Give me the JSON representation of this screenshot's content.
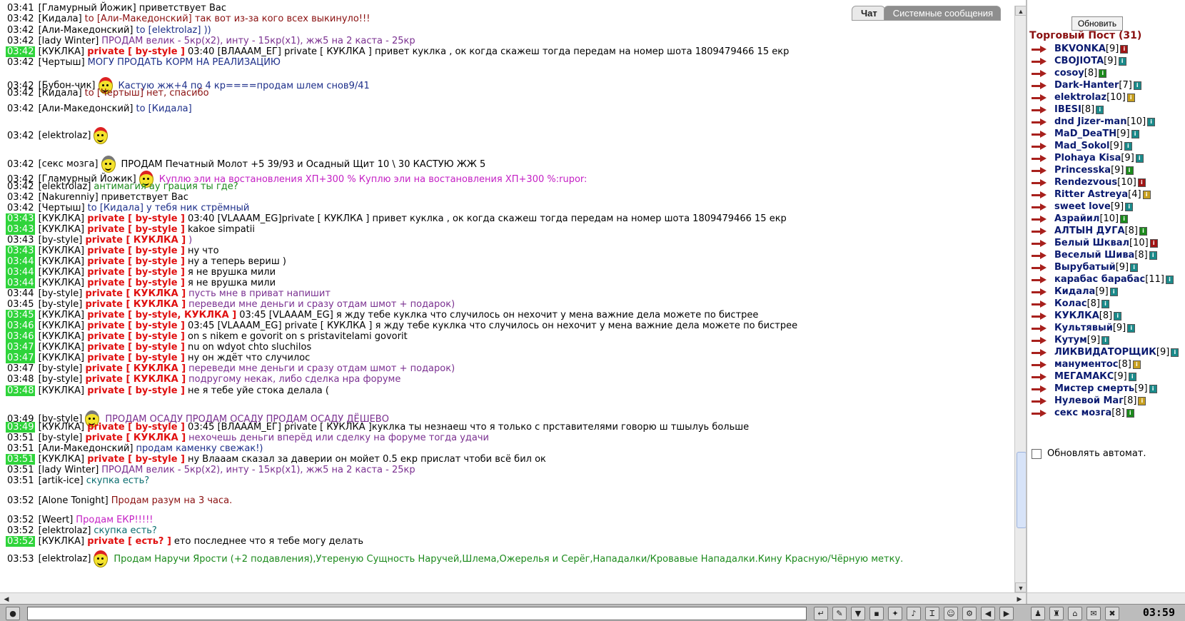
{
  "tabs": {
    "chat": "Чат",
    "system": "Системные сообщения"
  },
  "lines": [
    {
      "time": "03:41",
      "hl": false,
      "nick": "[Гламурный Йожик]",
      "priv": "",
      "msg": "приветствует Вас",
      "color": "c-black",
      "icons": []
    },
    {
      "time": "03:42",
      "hl": false,
      "nick": "[Кидала]",
      "priv": "",
      "msg": "to [Али-Македонский] так вот из-за кого всех выкинуло!!!",
      "color": "c-darkred",
      "icons": []
    },
    {
      "time": "03:42",
      "hl": false,
      "nick": "[Али-Македонский]",
      "priv": "",
      "msg": "to [elektrolaz] ))",
      "color": "c-blue",
      "icons": []
    },
    {
      "time": "03:42",
      "hl": false,
      "nick": "[lady Winter]",
      "priv": "",
      "msg": "ПРОДАМ велик - 5кр(х2), инту - 15кр(х1), жж5 на 2 каста - 25кр",
      "color": "c-purple",
      "icons": []
    },
    {
      "time": "03:42",
      "hl": true,
      "nick": "[КУКЛКА]",
      "priv": "private [ by-style ]",
      "msg": "03:40 [ВЛАААМ_ЕГ] private [ КУКЛКА ] привет куклка , ок когда скажеш тогда передам на номер шота 1809479466 15 екр",
      "color": "c-black",
      "icons": []
    },
    {
      "time": "03:42",
      "hl": false,
      "nick": "[Чертыш]",
      "priv": "",
      "msg": "МОГУ ПРОДАТЬ КОРМ НА РЕАЛИЗАЦИЮ",
      "color": "c-blue",
      "icons": []
    },
    {
      "time": "03:42",
      "hl": false,
      "nick": "[Бубон-чик]",
      "priv": "",
      "msg": "Кастую жж+4 по 4 кр====продам шлем снов9/41",
      "color": "c-blue",
      "icons": [
        "red"
      ]
    },
    {
      "time": "03:42",
      "hl": false,
      "nick": "[Кидала]",
      "priv": "",
      "msg": "to [Чертыш] нет, спасибо",
      "color": "c-darkred",
      "icons": []
    },
    {
      "time": "03:42",
      "hl": false,
      "nick": "[Али-Македонский]",
      "priv": "",
      "msg": "to [Кидала]",
      "color": "c-blue",
      "icons": []
    },
    {
      "time": "03:42",
      "hl": false,
      "nick": "[elektrolaz]",
      "priv": "",
      "msg": "",
      "color": "c-black",
      "icons": [
        "red"
      ]
    },
    {
      "time": "03:42",
      "hl": false,
      "nick": "[секс мозга]",
      "priv": "",
      "msg": "ПРОДАМ Печатный Молот +5 39/93      и Осадный Щит 10 \\ 30        КАСТУЮ ЖЖ 5",
      "color": "c-black",
      "icons": [
        "helm"
      ]
    },
    {
      "time": "03:42",
      "hl": false,
      "nick": "[Гламурный Йожик]",
      "priv": "",
      "msg": "Куплю эли на востановления ХП+300 %        Куплю эли на востановления ХП+300 %:rupor:",
      "color": "c-magenta",
      "icons": [
        "red"
      ]
    },
    {
      "time": "03:42",
      "hl": false,
      "nick": "[elektrolaz]",
      "priv": "",
      "msg": "антимагия ау грация ты где?",
      "color": "c-green",
      "icons": []
    },
    {
      "time": "03:42",
      "hl": false,
      "nick": "[Nakurenniy]",
      "priv": "",
      "msg": "приветствует Вас",
      "color": "c-black",
      "icons": []
    },
    {
      "time": "03:42",
      "hl": false,
      "nick": "[Чертыш]",
      "priv": "",
      "msg": "to [Кидала] у тебя ник стрёмный",
      "color": "c-blue",
      "icons": []
    },
    {
      "time": "03:43",
      "hl": true,
      "nick": "[КУКЛКА]",
      "priv": "private [ by-style ]",
      "msg": "03:40 [VLAAAM_EG]private [ КУКЛКА ] привет куклка , ок когда скажеш тогда передам на номер шота 1809479466 15 екр",
      "color": "c-black",
      "icons": []
    },
    {
      "time": "03:43",
      "hl": true,
      "nick": "[КУКЛКА]",
      "priv": "private [ by-style ]",
      "msg": "kakoe simpatii",
      "color": "c-black",
      "icons": []
    },
    {
      "time": "03:43",
      "hl": false,
      "nick": "[by-style]",
      "priv": "private [ КУКЛКА ]",
      "msg": ")",
      "color": "c-purple",
      "icons": []
    },
    {
      "time": "03:43",
      "hl": true,
      "nick": "[КУКЛКА]",
      "priv": "private [ by-style ]",
      "msg": "ну что",
      "color": "c-black",
      "icons": []
    },
    {
      "time": "03:44",
      "hl": true,
      "nick": "[КУКЛКА]",
      "priv": "private [ by-style ]",
      "msg": "ну а теперь вериш )",
      "color": "c-black",
      "icons": []
    },
    {
      "time": "03:44",
      "hl": true,
      "nick": "[КУКЛКА]",
      "priv": "private [ by-style ]",
      "msg": "я не врушка мили",
      "color": "c-black",
      "icons": []
    },
    {
      "time": "03:44",
      "hl": true,
      "nick": "[КУКЛКА]",
      "priv": "private [ by-style ]",
      "msg": "я не врушка мили",
      "color": "c-black",
      "icons": []
    },
    {
      "time": "03:44",
      "hl": false,
      "nick": "[by-style]",
      "priv": "private [ КУКЛКА ]",
      "msg": "пусть мне в приват напишит",
      "color": "c-purple",
      "icons": []
    },
    {
      "time": "03:45",
      "hl": false,
      "nick": "[by-style]",
      "priv": "private [ КУКЛКА ]",
      "msg": "переведи мне деньги и сразу отдам шмот + подарок)",
      "color": "c-purple",
      "icons": []
    },
    {
      "time": "03:45",
      "hl": true,
      "nick": "[КУКЛКА]",
      "priv": "private [ by-style, КУКЛКА ]",
      "msg": "03:45 [VLAAAM_EG] я жду тебе куклка что случилось он нехочит у мена важние дела можете по бистрее",
      "color": "c-black",
      "icons": []
    },
    {
      "time": "03:46",
      "hl": true,
      "nick": "[КУКЛКА]",
      "priv": "private [ by-style ]",
      "msg": "03:45 [VLAAAM_EG] private [ КУКЛКА ] я жду тебе куклка что случилось он нехочит у мена важние дела можете по бистрее",
      "color": "c-black",
      "icons": []
    },
    {
      "time": "03:46",
      "hl": true,
      "nick": "[КУКЛКА]",
      "priv": "private [ by-style ]",
      "msg": "on s nikem e govorit on s pristavitelami govorit",
      "color": "c-black",
      "icons": []
    },
    {
      "time": "03:47",
      "hl": true,
      "nick": "[КУКЛКА]",
      "priv": "private [ by-style ]",
      "msg": "nu on wdyot chto sluchilos",
      "color": "c-black",
      "icons": []
    },
    {
      "time": "03:47",
      "hl": true,
      "nick": "[КУКЛКА]",
      "priv": "private [ by-style ]",
      "msg": "ну он ждёт что случилос",
      "color": "c-black",
      "icons": []
    },
    {
      "time": "03:47",
      "hl": false,
      "nick": "[by-style]",
      "priv": "private [ КУКЛКА ]",
      "msg": "переведи мне деньги и сразу отдам шмот + подарок)",
      "color": "c-purple",
      "icons": []
    },
    {
      "time": "03:48",
      "hl": false,
      "nick": "[by-style]",
      "priv": "private [ КУКЛКА ]",
      "msg": "подругому некак, либо сделка нра форуме",
      "color": "c-purple",
      "icons": []
    },
    {
      "time": "03:48",
      "hl": true,
      "nick": "[КУКЛКА]",
      "priv": "private [ by-style ]",
      "msg": "не я тебе уйе стока делала (",
      "color": "c-black",
      "icons": []
    },
    {
      "time": "03:49",
      "hl": false,
      "nick": "[by-style]",
      "priv": "",
      "msg": "ПРОДАМ ОСАДУ          ПРОДАМ ОСАДУ          ПРОДАМ ОСАДУ          ДЁШЕВО",
      "color": "c-purple",
      "icons": [
        "helm"
      ]
    },
    {
      "time": "03:49",
      "hl": true,
      "nick": "[КУКЛКА]",
      "priv": "private [ by-style ]",
      "msg": "03:45 [ВЛАААМ_ЕГ] private [ КУКЛКА ]куклка ты незнаеш что я только с прставителями говорю ш тшылуь больше",
      "color": "c-black",
      "icons": []
    },
    {
      "time": "03:51",
      "hl": false,
      "nick": "[by-style]",
      "priv": "private [ КУКЛКА ]",
      "msg": "нехочешь деньги вперёд или сделку на форуме тогда удачи",
      "color": "c-purple",
      "icons": []
    },
    {
      "time": "03:51",
      "hl": false,
      "nick": "[Али-Македонский]",
      "priv": "",
      "msg": "продам каменку свежак!)",
      "color": "c-blue",
      "icons": []
    },
    {
      "time": "03:51",
      "hl": true,
      "nick": "[КУКЛКА]",
      "priv": "private [ by-style ]",
      "msg": "ну Влааам сказал за даверии он мойет 0.5 екр прислат чтоби всё бил ок",
      "color": "c-black",
      "icons": []
    },
    {
      "time": "03:51",
      "hl": false,
      "nick": "[lady Winter]",
      "priv": "",
      "msg": "ПРОДАМ велик - 5кр(х2), инту - 15кр(х1), жж5 на 2 каста - 25кр",
      "color": "c-purple",
      "icons": []
    },
    {
      "time": "03:51",
      "hl": false,
      "nick": "[artik-ice]",
      "priv": "",
      "msg": "скупка есть?",
      "color": "c-teal",
      "icons": []
    },
    {
      "time": "03:52",
      "hl": false,
      "nick": "[Alone Tonight]",
      "priv": "",
      "msg": "Продам разум на 3 часа.",
      "color": "c-darkred",
      "icons": []
    },
    {
      "time": "03:52",
      "hl": false,
      "nick": "[Weert]",
      "priv": "",
      "msg": "Продам ЕКР!!!!!",
      "color": "c-magenta",
      "icons": []
    },
    {
      "time": "03:52",
      "hl": false,
      "nick": "[elektrolaz]",
      "priv": "",
      "msg": "скупка есть?",
      "color": "c-teal",
      "icons": []
    },
    {
      "time": "03:52",
      "hl": true,
      "nick": "[КУКЛКА]",
      "priv": "private [ есть? ]",
      "msg": "ето последнее что я тебе могу делать",
      "color": "c-black",
      "icons": []
    },
    {
      "time": "03:53",
      "hl": false,
      "nick": "[elektrolaz]",
      "priv": "",
      "msg": "Продам Наручи Ярости (+2 подавления),Утереную Сущность Наручей,Шлема,Ожерелья и Серёг,Нападалки/Кровавые Нападалки.Кину Красную/Чёрную метку.",
      "color": "c-green",
      "icons": [
        "red"
      ]
    }
  ],
  "sidebar": {
    "refresh_label": "Обновить",
    "room_title": "Торговый Пост (31)",
    "auto_refresh_label": "Обновлять автомат.",
    "users": [
      {
        "name": "BKVONKA",
        "lvl": "[9]",
        "info": "#a01515"
      },
      {
        "name": "СВОЈIOTA",
        "lvl": "[9]",
        "info": "#1a8a8a"
      },
      {
        "name": "cosoy",
        "lvl": "[8]",
        "info": "#1c8a1c"
      },
      {
        "name": "Dark-Hanter",
        "lvl": "[7]",
        "info": "#1a8a8a"
      },
      {
        "name": "elektrolaz",
        "lvl": "[10]",
        "info": "#c8a020"
      },
      {
        "name": "IBESI",
        "lvl": "[8]",
        "info": "#1a8a8a"
      },
      {
        "name": "dnd Jizer-man",
        "lvl": "[10]",
        "info": "#1a8a8a"
      },
      {
        "name": "MaD_DeaTH",
        "lvl": "[9]",
        "info": "#1a8a8a"
      },
      {
        "name": "Mad_Sokol",
        "lvl": "[9]",
        "info": "#1a8a8a"
      },
      {
        "name": "Plohaya Kisa",
        "lvl": "[9]",
        "info": "#1a8a8a"
      },
      {
        "name": "Princesska",
        "lvl": "[9]",
        "info": "#1c8a1c"
      },
      {
        "name": "Rendezvous",
        "lvl": "[10]",
        "info": "#a01515"
      },
      {
        "name": "Ritter Astreya",
        "lvl": "[4]",
        "info": "#c8a020"
      },
      {
        "name": "sweet love",
        "lvl": "[9]",
        "info": "#1a8a8a"
      },
      {
        "name": "Азрайил",
        "lvl": "[10]",
        "info": "#1c8a1c"
      },
      {
        "name": "АЛТЫН ДУГА",
        "lvl": "[8]",
        "info": "#1c8a1c"
      },
      {
        "name": "Белый Шквал",
        "lvl": "[10]",
        "info": "#a01515"
      },
      {
        "name": "Веселый Шива",
        "lvl": "[8]",
        "info": "#1a8a8a"
      },
      {
        "name": "Вырубатый",
        "lvl": "[9]",
        "info": "#1a8a8a"
      },
      {
        "name": "карабас барабас",
        "lvl": "[11]",
        "info": "#1a8a8a"
      },
      {
        "name": "Кидала",
        "lvl": "[9]",
        "info": "#1a8a8a"
      },
      {
        "name": "Колас",
        "lvl": "[8]",
        "info": "#1a8a8a"
      },
      {
        "name": "КУКЛКА",
        "lvl": "[8]",
        "info": "#1a8a8a"
      },
      {
        "name": "Культявый",
        "lvl": "[9]",
        "info": "#1a8a8a"
      },
      {
        "name": "Кутум",
        "lvl": "[9]",
        "info": "#1a8a8a"
      },
      {
        "name": "ЛИКВИДАТОРЩИК",
        "lvl": "[9]",
        "info": "#1a8a8a"
      },
      {
        "name": "манументос",
        "lvl": "[8]",
        "info": "#c8a020"
      },
      {
        "name": "МЕГАМАКС",
        "lvl": "[9]",
        "info": "#1a8a8a"
      },
      {
        "name": "Мистер смерть",
        "lvl": "[9]",
        "info": "#1a8a8a"
      },
      {
        "name": "Нулевой Маг",
        "lvl": "[8]",
        "info": "#c8a020"
      },
      {
        "name": "секс мозга",
        "lvl": "[8]",
        "info": "#1c8a1c"
      }
    ]
  },
  "bottombar": {
    "clock": "03:59"
  }
}
